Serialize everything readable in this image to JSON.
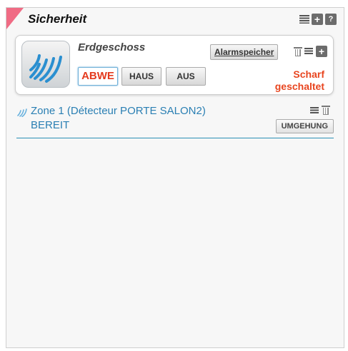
{
  "panel": {
    "title": "Sicherheit",
    "header_icons": [
      "list-icon",
      "plus-icon",
      "help-icon"
    ],
    "accent_color": "#f06b84"
  },
  "device": {
    "name": "Erdgeschoss",
    "icon": "alarm-signal-icon",
    "alarm_memory_label": "Alarmspeicher",
    "modes": [
      {
        "label": "ABWE",
        "active": true
      },
      {
        "label": "HAUS",
        "active": false
      },
      {
        "label": "AUS",
        "active": false
      }
    ],
    "status": "Scharf geschaltet",
    "status_color": "#e8451f"
  },
  "zone": {
    "name": "Zone 1 (Détecteur PORTE SALON2)",
    "status": "BEREIT",
    "bypass_label": "UMGEHUNG",
    "color": "#2a7fb3"
  }
}
